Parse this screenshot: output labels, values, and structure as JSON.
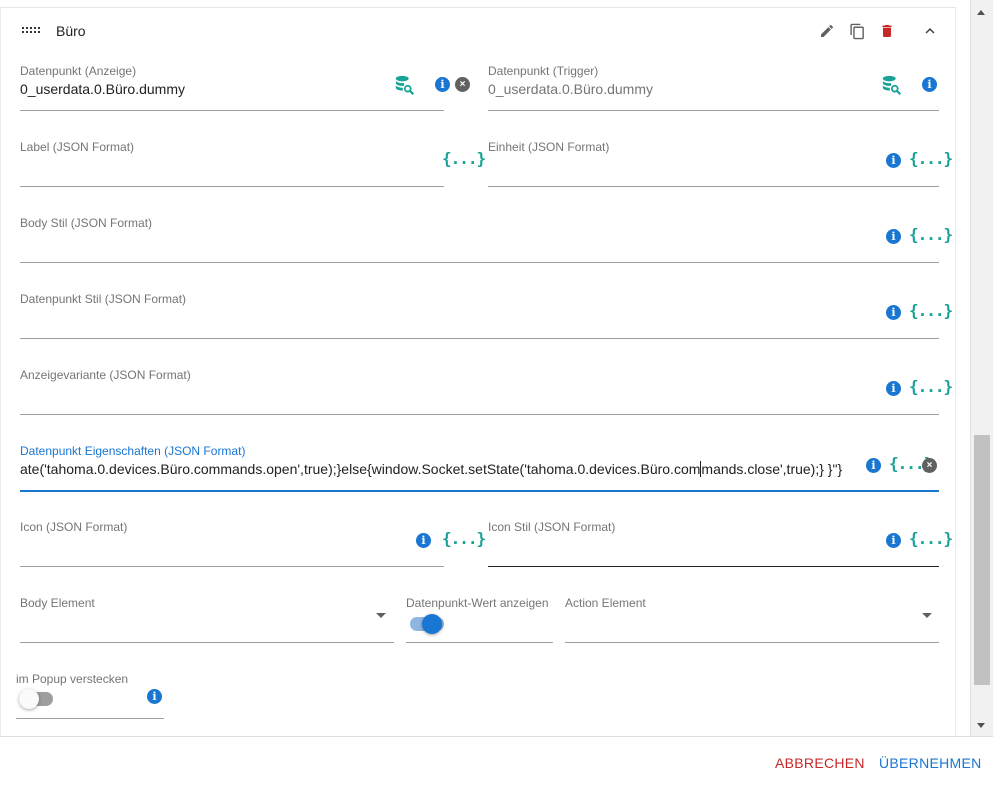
{
  "card": {
    "title": "Büro"
  },
  "fields": {
    "dp_display": {
      "label": "Datenpunkt (Anzeige)",
      "value": "0_userdata.0.Büro.dummy"
    },
    "dp_trigger": {
      "label": "Datenpunkt (Trigger)",
      "value": "0_userdata.0.Büro.dummy"
    },
    "label": {
      "label": "Label (JSON Format)"
    },
    "unit": {
      "label": "Einheit (JSON Format)"
    },
    "body_style": {
      "label": "Body Stil (JSON Format)"
    },
    "dp_style": {
      "label": "Datenpunkt Stil (JSON Format)"
    },
    "display_variant": {
      "label": "Anzeigevariante (JSON Format)"
    },
    "dp_props": {
      "label": "Datenpunkt Eigenschaften (JSON Format)",
      "value_part1": "ate('tahoma.0.devices.Büro.commands.open',true);}",
      "value_err": "else{window.Socket.setState",
      "value_part2": "('tahoma.0.devices.Büro.com",
      "value_part3": "mands.close',true);} }\"}"
    },
    "icon": {
      "label": "Icon (JSON Format)"
    },
    "icon_style": {
      "label": "Icon Stil (JSON Format)"
    },
    "body_element": {
      "label": "Body Element"
    },
    "show_dp_value": {
      "label": "Datenpunkt-Wert anzeigen",
      "checked": true
    },
    "action_element": {
      "label": "Action Element"
    },
    "hide_in_popup": {
      "label": "im Popup verstecken",
      "checked": false
    }
  },
  "icons": {
    "json": "{...}",
    "info": "i",
    "clear": "×"
  },
  "footer": {
    "cancel": "ABBRECHEN",
    "apply": "ÜBERNEHMEN"
  },
  "colors": {
    "primary": "#1976d2",
    "danger": "#c62828",
    "teal": "#17a397"
  }
}
